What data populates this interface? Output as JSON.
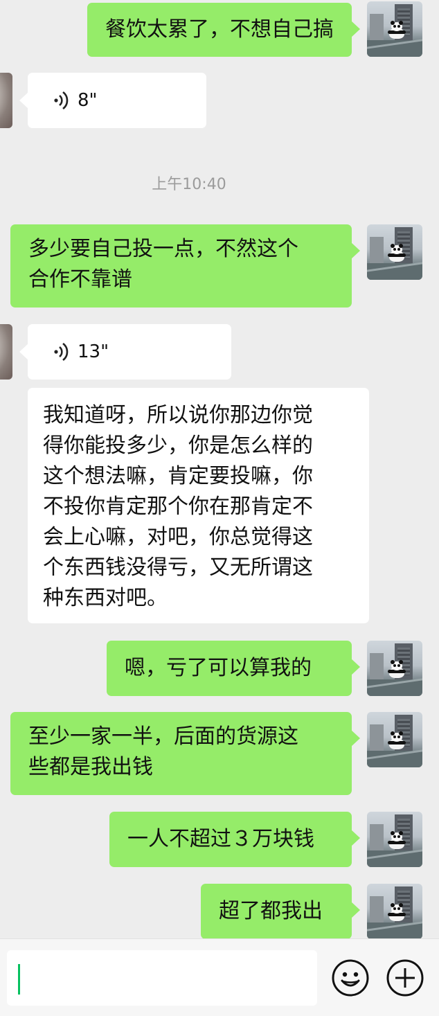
{
  "messages": [
    {
      "side": "me",
      "kind": "text",
      "text": "餐饮太累了，不想自己搞"
    },
    {
      "side": "other",
      "kind": "voice",
      "duration": "8\""
    },
    {
      "kind": "time",
      "text": "上午10:40"
    },
    {
      "side": "me",
      "kind": "text",
      "lines": [
        "多少要自己投一点，不然这个",
        "合作不靠谱"
      ]
    },
    {
      "side": "other",
      "kind": "voice",
      "duration": "13\""
    },
    {
      "side": "other",
      "kind": "text",
      "lines": [
        "我知道呀，所以说你那边你觉",
        "得你能投多少，你是怎么样的",
        "这个想法嘛，肯定要投嘛，你",
        "不投你肯定那个你在那肯定不",
        "会上心嘛，对吧，你总觉得这",
        "个东西钱没得亏，又无所谓这",
        "种东西对吧。"
      ]
    },
    {
      "side": "me",
      "kind": "text",
      "text": "嗯，亏了可以算我的"
    },
    {
      "side": "me",
      "kind": "text",
      "lines": [
        "至少一家一半，后面的货源这",
        "些都是我出钱"
      ]
    },
    {
      "side": "me",
      "kind": "text",
      "text": "一人不超过３万块钱"
    },
    {
      "side": "me",
      "kind": "text",
      "text": "超了都我出"
    }
  ],
  "input_bar": {
    "emoji_icon": "emoji-face-icon",
    "plus_icon": "plus-circle-icon"
  },
  "colors": {
    "my_bubble": "#95ec69",
    "other_bubble": "#ffffff",
    "background": "#ededed",
    "cursor": "#07c160"
  }
}
